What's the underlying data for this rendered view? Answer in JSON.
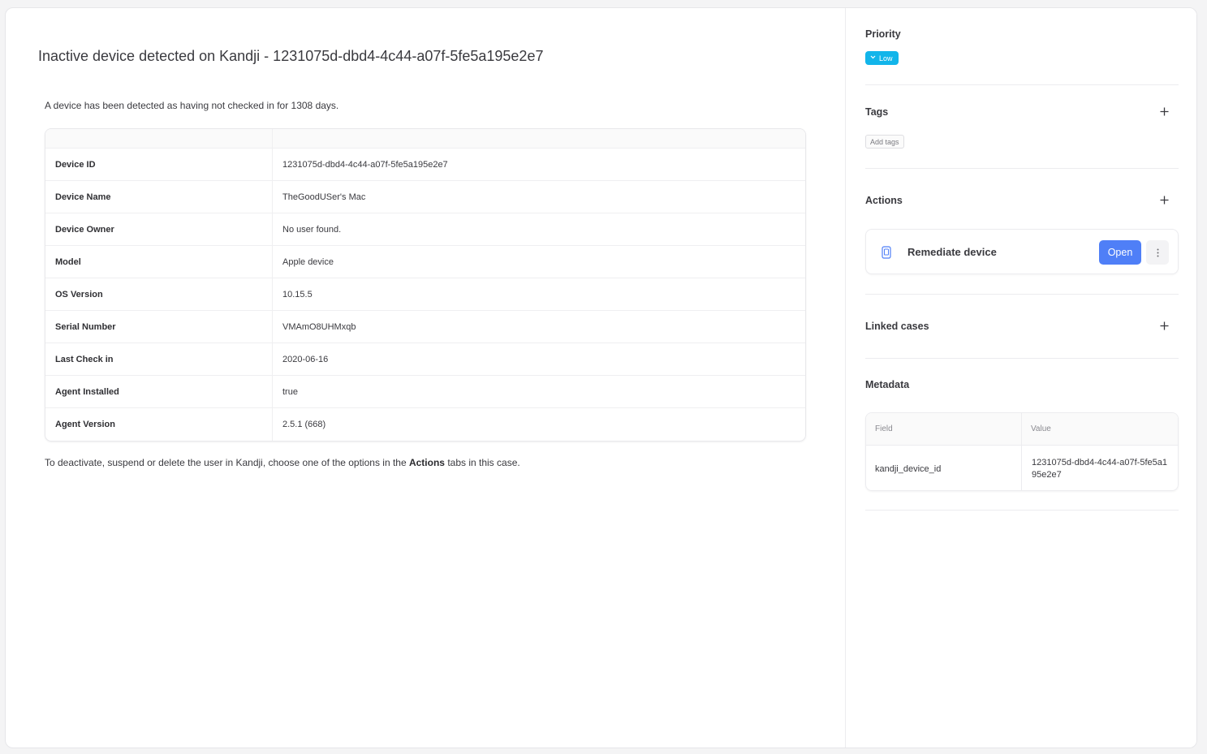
{
  "case": {
    "title": "Inactive device detected on Kandji - 1231075d-dbd4-4c44-a07f-5fe5a195e2e7",
    "intro": "A device has been detected as having not checked in for 1308 days.",
    "outro_prefix": "To deactivate, suspend or delete the user in Kandji, choose one of the options in the ",
    "outro_bold": "Actions",
    "outro_suffix": " tabs in this case."
  },
  "device_table": {
    "rows": [
      {
        "key": "Device ID",
        "value": "1231075d-dbd4-4c44-a07f-5fe5a195e2e7"
      },
      {
        "key": "Device Name",
        "value": "TheGoodUSer's Mac"
      },
      {
        "key": "Device Owner",
        "value": "No user found."
      },
      {
        "key": "Model",
        "value": "Apple device"
      },
      {
        "key": "OS Version",
        "value": "10.15.5"
      },
      {
        "key": "Serial Number",
        "value": "VMAmO8UHMxqb"
      },
      {
        "key": "Last Check in",
        "value": "2020-06-16"
      },
      {
        "key": "Agent Installed",
        "value": "true"
      },
      {
        "key": "Agent Version",
        "value": "2.5.1 (668)"
      }
    ]
  },
  "sidebar": {
    "priority": {
      "label": "Priority",
      "value": "Low",
      "color": "#12b5ea"
    },
    "tags": {
      "label": "Tags",
      "add_label": "Add tags"
    },
    "actions": {
      "label": "Actions",
      "items": [
        {
          "label": "Remediate device",
          "button": "Open",
          "icon": "device-icon"
        }
      ]
    },
    "linked_cases": {
      "label": "Linked cases"
    },
    "metadata": {
      "label": "Metadata",
      "headers": {
        "field": "Field",
        "value": "Value"
      },
      "rows": [
        {
          "field": "kandji_device_id",
          "value": "1231075d-dbd4-4c44-a07f-5fe5a195e2e7"
        }
      ]
    }
  },
  "accent": {
    "primary": "#4f7ff7"
  }
}
